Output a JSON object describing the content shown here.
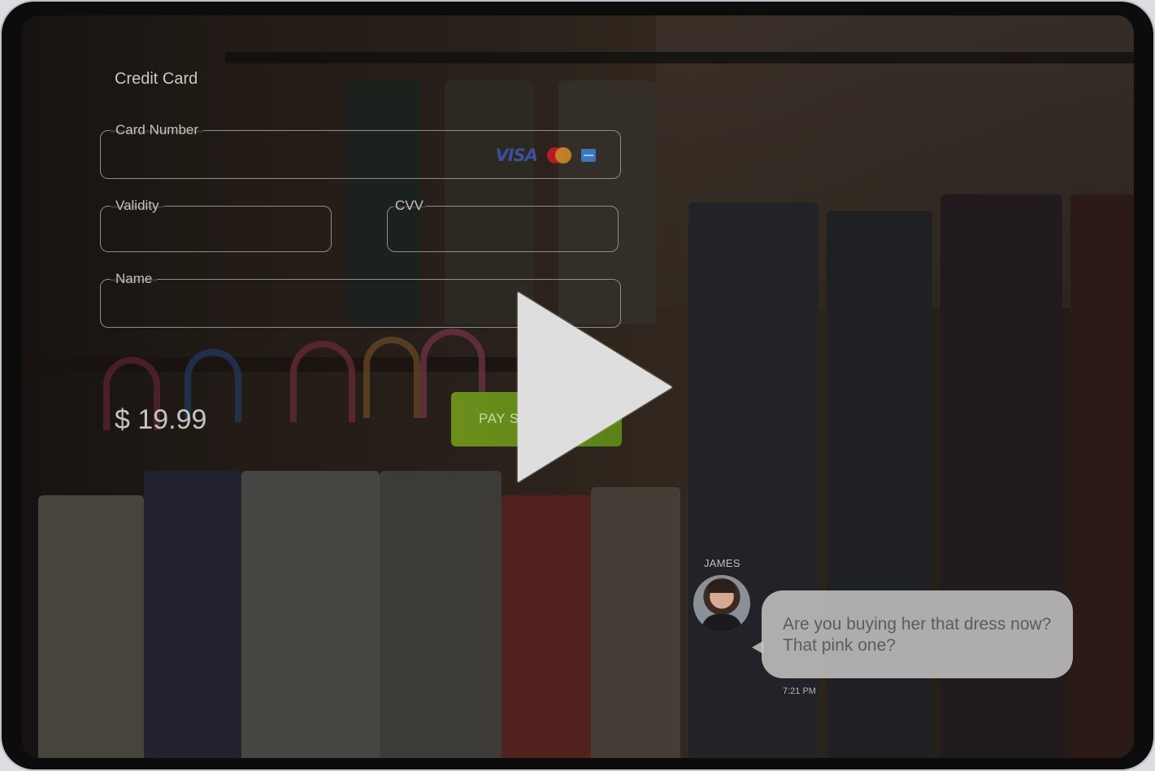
{
  "form": {
    "title": "Credit Card",
    "card_number": {
      "label": "Card Number",
      "value": ""
    },
    "validity": {
      "label": "Validity",
      "value": ""
    },
    "cvv": {
      "label": "CVV",
      "value": ""
    },
    "name": {
      "label": "Name",
      "value": ""
    },
    "card_logos": [
      "visa-logo",
      "mastercard-logo",
      "amex-logo"
    ],
    "visa_text": "VISA"
  },
  "price": "$ 19.99",
  "pay_button": {
    "label": "PAY S"
  },
  "video": {
    "play_icon": "play-icon"
  },
  "chat": {
    "sender": "JAMES",
    "message": "Are you buying her that dress now? That pink one?",
    "time": "7:21 PM"
  },
  "colors": {
    "pay_button": "#6c8f1c",
    "bubble": "#cdcdcd",
    "play": "#dedede"
  }
}
